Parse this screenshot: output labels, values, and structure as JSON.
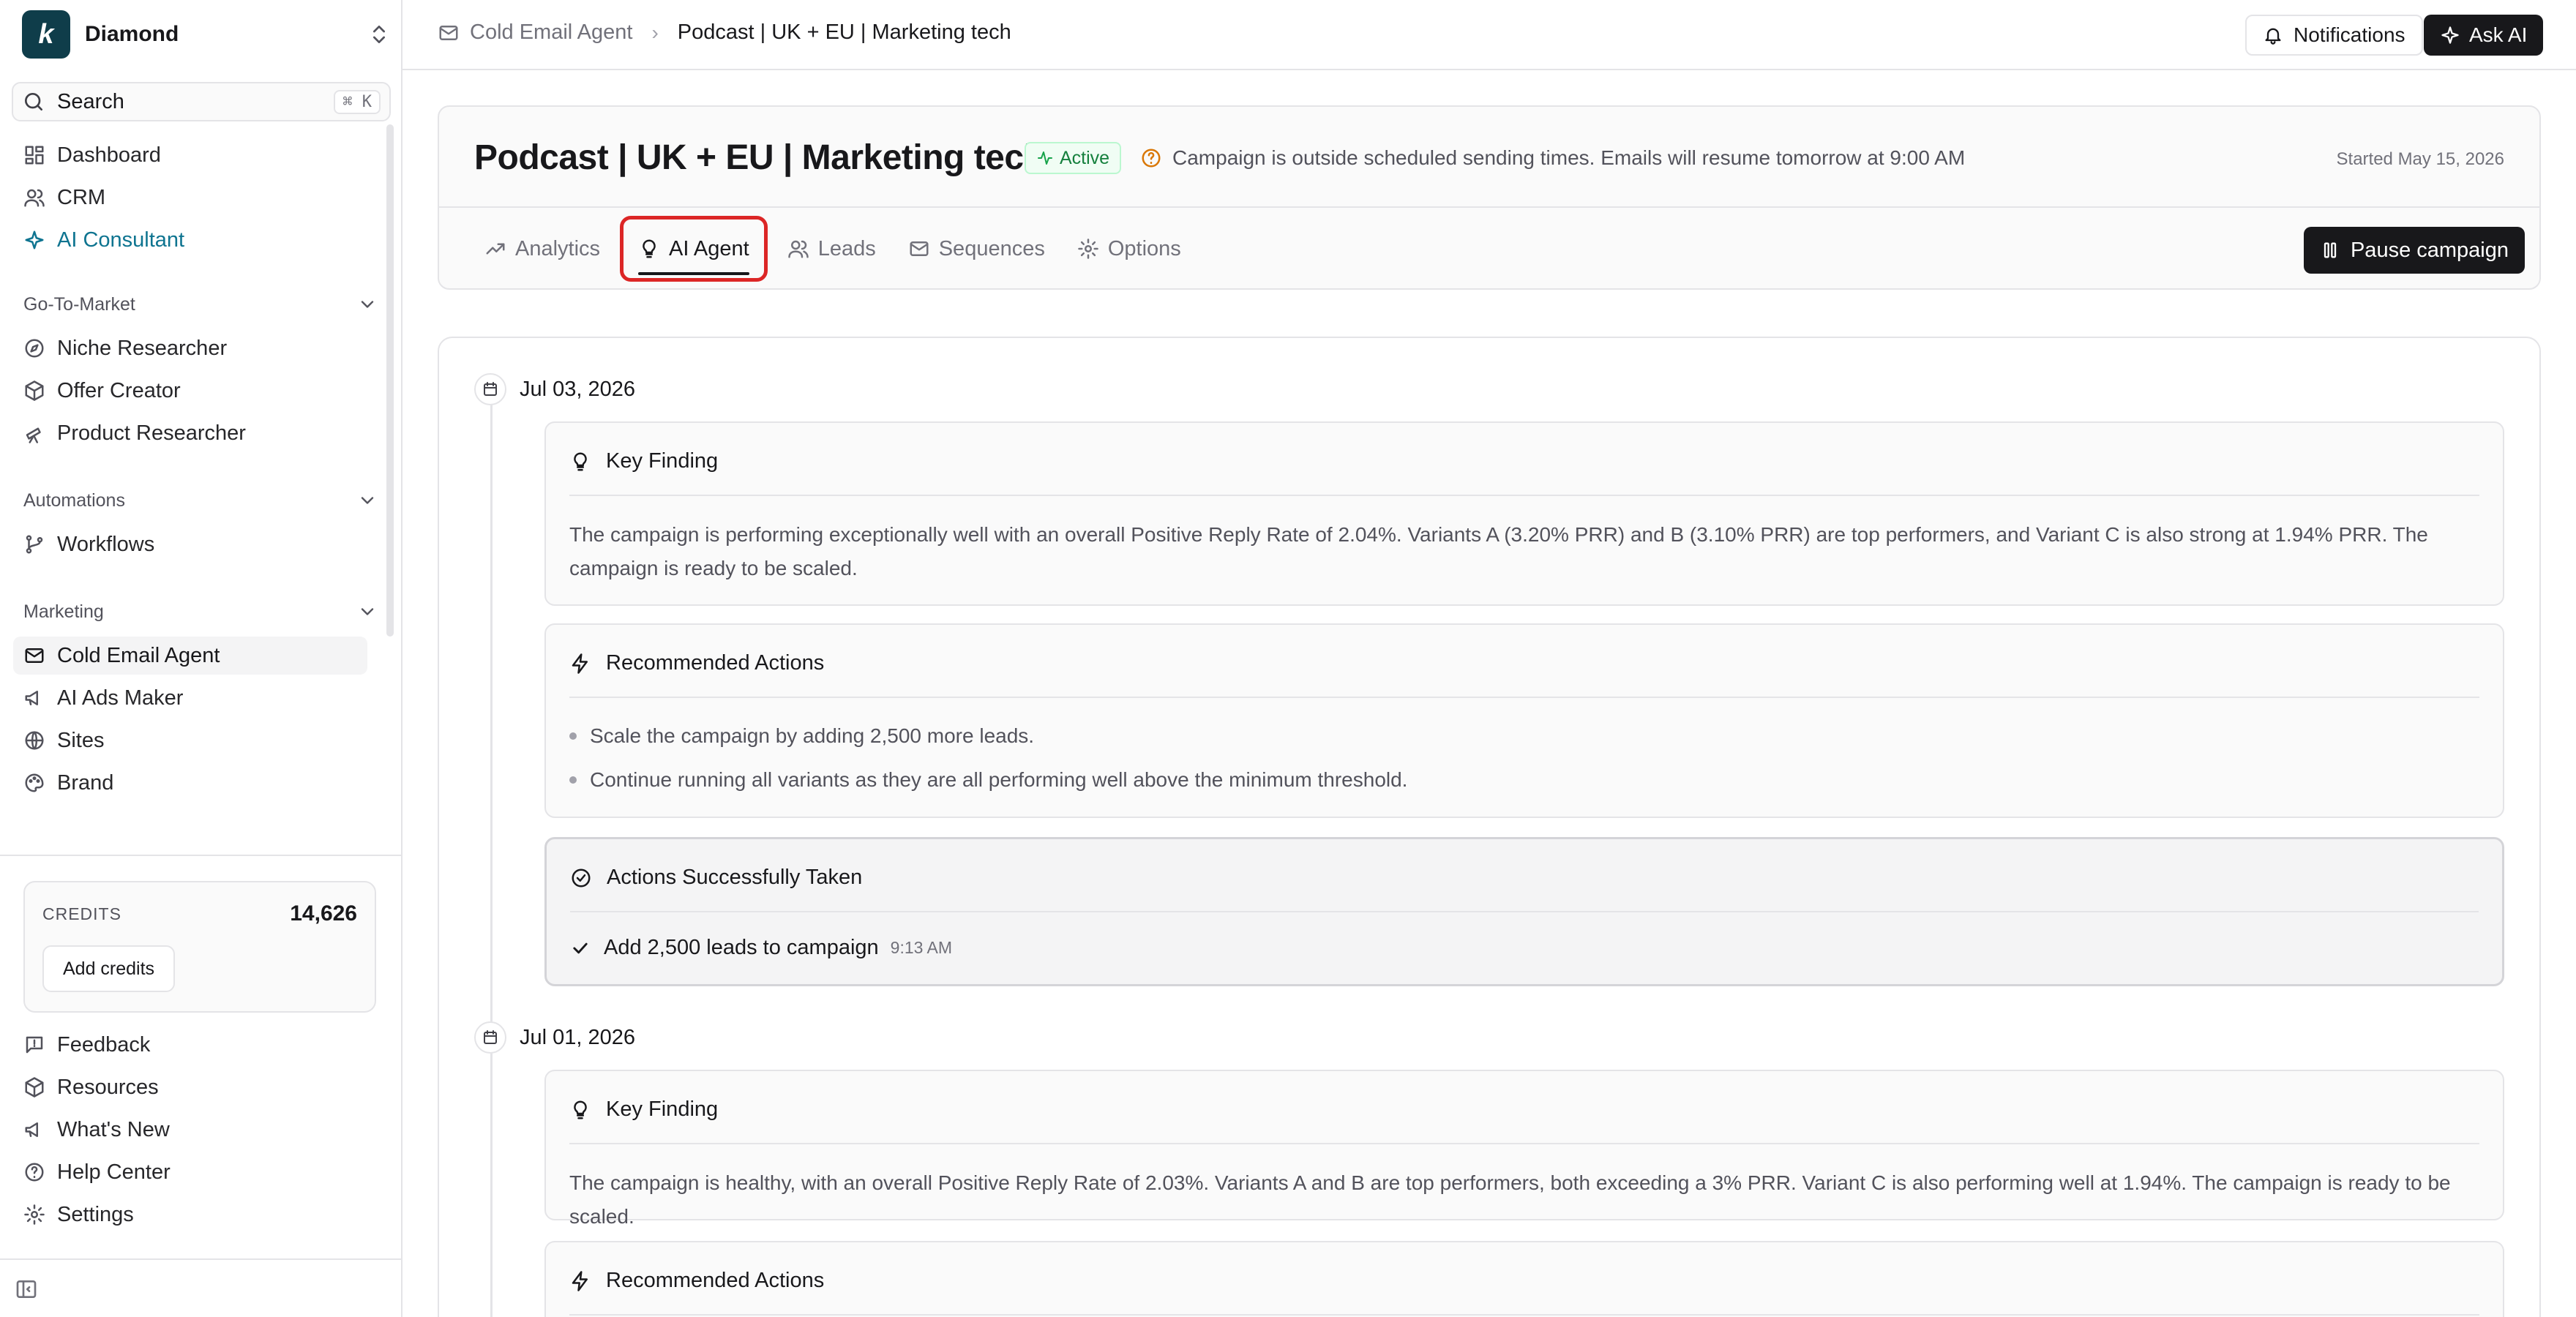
{
  "workspace": {
    "name": "Diamond",
    "logo_letter": "k"
  },
  "search": {
    "label": "Search",
    "shortcut": "⌘ K"
  },
  "sidebar": {
    "top_items": [
      {
        "label": "Dashboard",
        "icon": "dashboard-icon"
      },
      {
        "label": "CRM",
        "icon": "users-icon"
      },
      {
        "label": "AI Consultant",
        "icon": "sparkle-icon"
      }
    ],
    "sections": [
      {
        "title": "Go-To-Market",
        "items": [
          {
            "label": "Niche Researcher",
            "icon": "compass-icon"
          },
          {
            "label": "Offer Creator",
            "icon": "package-icon"
          },
          {
            "label": "Product Researcher",
            "icon": "telescope-icon"
          }
        ]
      },
      {
        "title": "Automations",
        "items": [
          {
            "label": "Workflows",
            "icon": "workflow-icon"
          }
        ]
      },
      {
        "title": "Marketing",
        "items": [
          {
            "label": "Cold Email Agent",
            "icon": "mail-icon"
          },
          {
            "label": "AI Ads Maker",
            "icon": "megaphone-icon"
          },
          {
            "label": "Sites",
            "icon": "globe-icon"
          },
          {
            "label": "Brand",
            "icon": "palette-icon"
          }
        ]
      }
    ],
    "credits": {
      "label": "CREDITS",
      "value": "14,626",
      "button": "Add credits"
    },
    "bottom_items": [
      {
        "label": "Feedback",
        "icon": "feedback-icon"
      },
      {
        "label": "Resources",
        "icon": "box-icon"
      },
      {
        "label": "What's New",
        "icon": "megaphone-icon"
      },
      {
        "label": "Help Center",
        "icon": "help-icon"
      },
      {
        "label": "Settings",
        "icon": "gear-icon"
      }
    ]
  },
  "breadcrumb": {
    "parent": "Cold Email Agent",
    "current": "Podcast | UK + EU | Marketing tech"
  },
  "topbar": {
    "notifications": "Notifications",
    "ask_ai": "Ask AI"
  },
  "campaign": {
    "title": "Podcast | UK + EU | Marketing tech",
    "status": "Active",
    "notice": "Campaign is outside scheduled sending times. Emails will resume tomorrow at 9:00 AM",
    "started": "Started May 15, 2026",
    "tabs": [
      "Analytics",
      "AI Agent",
      "Leads",
      "Sequences",
      "Options"
    ],
    "active_tab": "AI Agent",
    "pause_button": "Pause campaign"
  },
  "timeline": [
    {
      "date": "Jul 03, 2026",
      "key_finding": {
        "title": "Key Finding",
        "text": "The campaign is performing exceptionally well with an overall Positive Reply Rate of 2.04%. Variants A (3.20% PRR) and B (3.10% PRR) are top performers, and Variant C is also strong at 1.94% PRR. The campaign is ready to be scaled."
      },
      "recommended": {
        "title": "Recommended Actions",
        "items": [
          "Scale the campaign by adding 2,500 more leads.",
          "Continue running all variants as they are all performing well above the minimum threshold."
        ]
      },
      "taken": {
        "title": "Actions Successfully Taken",
        "item": "Add 2,500 leads to campaign",
        "time": "9:13 AM"
      }
    },
    {
      "date": "Jul 01, 2026",
      "key_finding": {
        "title": "Key Finding",
        "text": "The campaign is healthy, with an overall Positive Reply Rate of 2.03%. Variants A and B are top performers, both exceeding a 3% PRR. Variant C is also performing well at 1.94%. The campaign is ready to be scaled."
      },
      "recommended": {
        "title": "Recommended Actions"
      }
    }
  ],
  "colors": {
    "accent": "#0e7490",
    "active_badge": "#15803d",
    "warning": "#d97706",
    "highlight": "#dc2626"
  }
}
